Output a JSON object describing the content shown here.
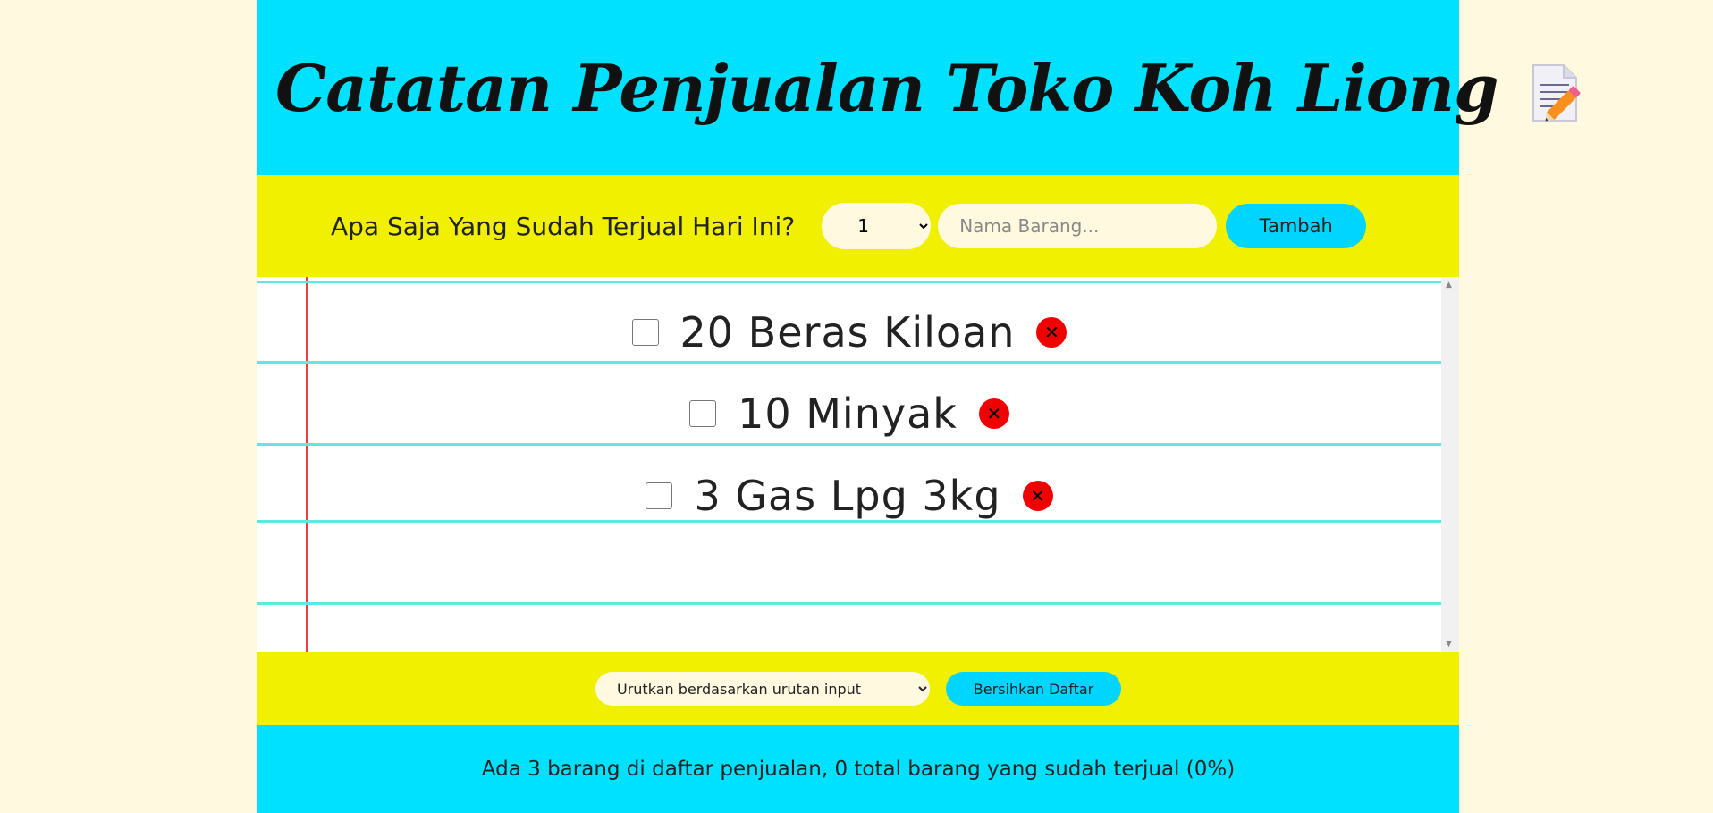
{
  "header": {
    "title": "Catatan Penjualan Toko Koh Liong",
    "icon": "memo-icon"
  },
  "form": {
    "question": "Apa Saja Yang Sudah Terjual Hari Ini?",
    "quantity_selected": "1",
    "name_placeholder": "Nama Barang...",
    "add_label": "Tambah"
  },
  "items": [
    {
      "text": "20 Beras Kiloan",
      "checked": false
    },
    {
      "text": "10 Minyak",
      "checked": false
    },
    {
      "text": "3 Gas Lpg 3kg",
      "checked": false
    }
  ],
  "controls": {
    "sort_selected": "Urutkan berdasarkan urutan input",
    "clear_label": "Bersihkan Daftar"
  },
  "footer": {
    "stats": "Ada 3 barang di daftar penjualan, 0 total barang yang sudah terjual (0%)"
  },
  "colors": {
    "header_bg": "#00e1ff",
    "bar_bg": "#f0f000",
    "page_bg": "#fff9e0",
    "delete_red": "#f00000"
  }
}
